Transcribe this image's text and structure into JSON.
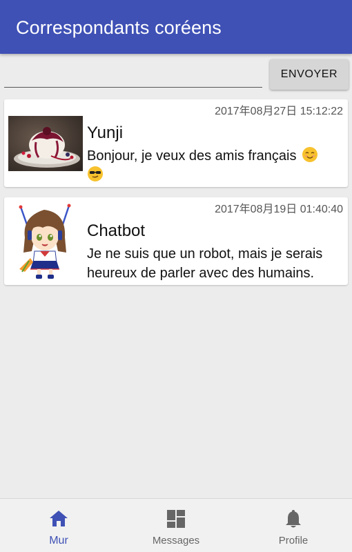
{
  "app": {
    "title": "Correspondants coréens",
    "accent_color": "#3f51b5"
  },
  "compose": {
    "input_value": "",
    "send_label": "ENVOYER"
  },
  "feed": [
    {
      "author": "Yunji",
      "timestamp": "2017年08月27日 15:12:22",
      "message": "Bonjour, je veux des amis français",
      "emojis": [
        "smiling-emoji",
        "sunglasses-emoji"
      ],
      "avatar": "dessert-photo"
    },
    {
      "author": "Chatbot",
      "timestamp": "2017年08月19日 01:40:40",
      "message": "Je ne suis que un robot, mais je serais heureux de parler avec des humains.",
      "avatar": "anime-robot-girl"
    }
  ],
  "bottom_nav": {
    "items": [
      {
        "label": "Mur",
        "icon": "home-icon",
        "active": true
      },
      {
        "label": "Messages",
        "icon": "dashboard-icon",
        "active": false
      },
      {
        "label": "Profile",
        "icon": "bell-icon",
        "active": false
      }
    ]
  }
}
